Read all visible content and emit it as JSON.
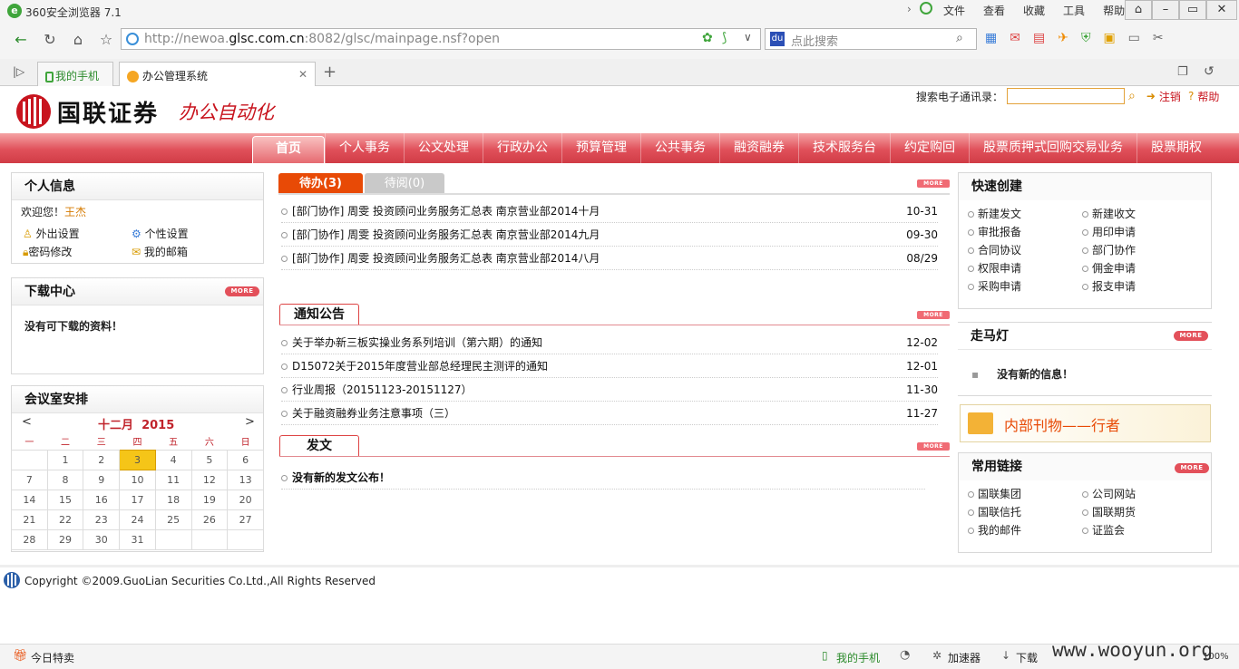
{
  "browser": {
    "app_title": "360安全浏览器 7.1",
    "menu": [
      "文件",
      "查看",
      "收藏",
      "工具",
      "帮助"
    ],
    "url_prefix": "http://newoa.",
    "url_host": "glsc.com.cn",
    "url_suffix": ":8082/glsc/mainpage.nsf?open",
    "search_placeholder": "点此搜索",
    "tabs": [
      {
        "label": "我的手机"
      },
      {
        "label": "办公管理系统"
      }
    ],
    "status_left": "今日特卖",
    "status_items": [
      "我的手机",
      "加速器",
      "下载"
    ],
    "zoom": "100%",
    "watermark": "www.wooyun.org"
  },
  "header": {
    "brand_name": "国联证券",
    "brand_sub": "办公自动化",
    "search_label": "搜索电子通讯录：",
    "logout": "注销",
    "help": "帮助"
  },
  "nav": [
    "首页",
    "个人事务",
    "公文处理",
    "行政办公",
    "预算管理",
    "公共事务",
    "融资融券",
    "技术服务台",
    "约定购回",
    "股票质押式回购交易业务",
    "股票期权"
  ],
  "personal": {
    "title": "个人信息",
    "welcome": "欢迎您！",
    "user": "王杰",
    "links": [
      "外出设置",
      "个性设置",
      "密码修改",
      "我的邮箱"
    ]
  },
  "download": {
    "title": "下载中心",
    "more": "MORE",
    "empty": "没有可下载的资料！"
  },
  "meeting": {
    "title": "会议室安排",
    "month": "十二月",
    "year": "2015",
    "prev": "<",
    "next": ">",
    "weekdays": [
      "一",
      "二",
      "三",
      "四",
      "五",
      "六",
      "日"
    ],
    "today": "3",
    "weeks": [
      [
        "",
        "1",
        "2",
        "3",
        "4",
        "5",
        "6"
      ],
      [
        "7",
        "8",
        "9",
        "10",
        "11",
        "12",
        "13"
      ],
      [
        "14",
        "15",
        "16",
        "17",
        "18",
        "19",
        "20"
      ],
      [
        "21",
        "22",
        "23",
        "24",
        "25",
        "26",
        "27"
      ],
      [
        "28",
        "29",
        "30",
        "31",
        "",
        "",
        ""
      ]
    ]
  },
  "todo": {
    "tab_active": "待办(3)",
    "tab_other": "待阅(0)",
    "more": "MORE",
    "items": [
      {
        "text": "[部门协作] 周雯 投资顾问业务服务汇总表 南京营业部2014十月",
        "date": "10-31"
      },
      {
        "text": "[部门协作] 周雯 投资顾问业务服务汇总表 南京营业部2014九月",
        "date": "09-30"
      },
      {
        "text": "[部门协作] 周雯 投资顾问业务服务汇总表 南京营业部2014八月",
        "date": "08/29"
      }
    ]
  },
  "notice": {
    "title": "通知公告",
    "more": "MORE",
    "items": [
      {
        "text": "关于举办新三板实操业务系列培训（第六期）的通知",
        "date": "12-02"
      },
      {
        "text": "D15072关于2015年度营业部总经理民主测评的通知",
        "date": "12-01"
      },
      {
        "text": "行业周报（20151123-20151127）",
        "date": "11-30"
      },
      {
        "text": "关于融资融券业务注意事项（三）",
        "date": "11-27"
      }
    ]
  },
  "dispatch": {
    "title": "发文",
    "more": "MORE",
    "empty": "没有新的发文公布！"
  },
  "quick": {
    "title": "快速创建",
    "items": [
      "新建发文",
      "新建收文",
      "审批报备",
      "用印申请",
      "合同协议",
      "部门协作",
      "权限申请",
      "佣金申请",
      "采购申请",
      "报支申请"
    ]
  },
  "marquee": {
    "title": "走马灯",
    "more": "MORE",
    "empty": "没有新的信息！"
  },
  "journal": {
    "label": "内部刊物——行者"
  },
  "links": {
    "title": "常用链接",
    "more": "MORE",
    "items": [
      "国联集团",
      "公司网站",
      "国联信托",
      "国联期货",
      "我的邮件",
      "证监会"
    ]
  },
  "footer": {
    "copyright": "Copyright ©2009.GuoLian Securities Co.Ltd.,All Rights Reserved"
  },
  "colors": {
    "brand_red": "#c8141e",
    "nav_red": "#e0505a",
    "tab_orange": "#e84a06",
    "user_orange": "#d67a00"
  }
}
